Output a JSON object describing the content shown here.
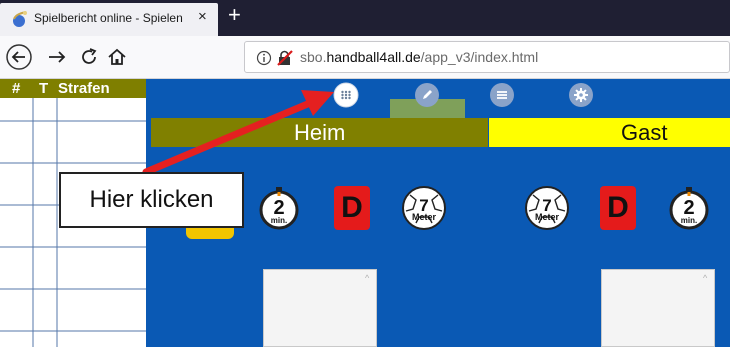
{
  "browser": {
    "tab_title": "Spielbericht online - Spielen",
    "tab_close": "×",
    "new_tab": "+",
    "url": {
      "prefix": "sbo.",
      "domain": "handball4all.de",
      "path": "/app_v3/index.html"
    }
  },
  "penalties": {
    "col_number": "#",
    "col_t": "T",
    "col_strafen": "Strafen"
  },
  "teams": {
    "home": "Heim",
    "away": "Gast"
  },
  "controls": {
    "timeout_value": "2",
    "timeout_unit": "min.",
    "disqualification": "D",
    "seven_m_value": "7",
    "seven_m_unit": "Meter"
  },
  "annotation": {
    "callout": "Hier klicken"
  },
  "colors": {
    "app_background": "#0a59b4",
    "home_bar": "#808000",
    "away_bar": "#ffff00",
    "arrow": "#e52020",
    "disqualification_button": "#e41b1b"
  }
}
